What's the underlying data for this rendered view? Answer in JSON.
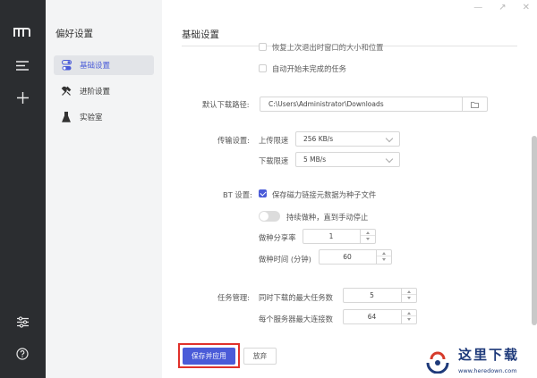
{
  "rail": {
    "icons": [
      "logo-icon",
      "menu-icon",
      "plus-icon",
      "sliders-icon",
      "help-icon"
    ]
  },
  "sidebar": {
    "title": "偏好设置",
    "items": [
      {
        "label": "基础设置",
        "icon": "toggle-icon",
        "active": true
      },
      {
        "label": "进阶设置",
        "icon": "tools-icon",
        "active": false
      },
      {
        "label": "实验室",
        "icon": "flask-icon",
        "active": false
      }
    ]
  },
  "main": {
    "heading": "基础设置",
    "restore_window": "恢复上次退出时窗口的大小和位置",
    "auto_resume": "自动开始未完成的任务",
    "download_path": {
      "label": "默认下载路径:",
      "value": "C:\\Users\\Administrator\\Downloads"
    },
    "transfer": {
      "label": "传输设置:",
      "upload_label": "上传限速",
      "upload_value": "256 KB/s",
      "download_label": "下载限速",
      "download_value": "5 MB/s"
    },
    "bt": {
      "label": "BT 设置:",
      "save_magnet": "保存磁力链接元数据为种子文件",
      "keep_seeding": "持续做种，直到手动停止",
      "seed_ratio_label": "做种分享率",
      "seed_ratio_value": "1",
      "seed_time_label": "做种时间 (分钟)",
      "seed_time_value": "60"
    },
    "task": {
      "label": "任务管理:",
      "max_tasks_label": "同时下载的最大任务数",
      "max_tasks_value": "5",
      "max_conn_label": "每个服务器最大连接数",
      "max_conn_value": "64"
    },
    "buttons": {
      "save": "保存并应用",
      "discard": "放弃"
    }
  },
  "watermark": {
    "title": "这里下载",
    "url": "www.heredown.com"
  },
  "colors": {
    "accent": "#4a5bd8",
    "rail": "#2b2d30",
    "sidebar": "#f3f4f5",
    "highlight": "#e0312b"
  }
}
